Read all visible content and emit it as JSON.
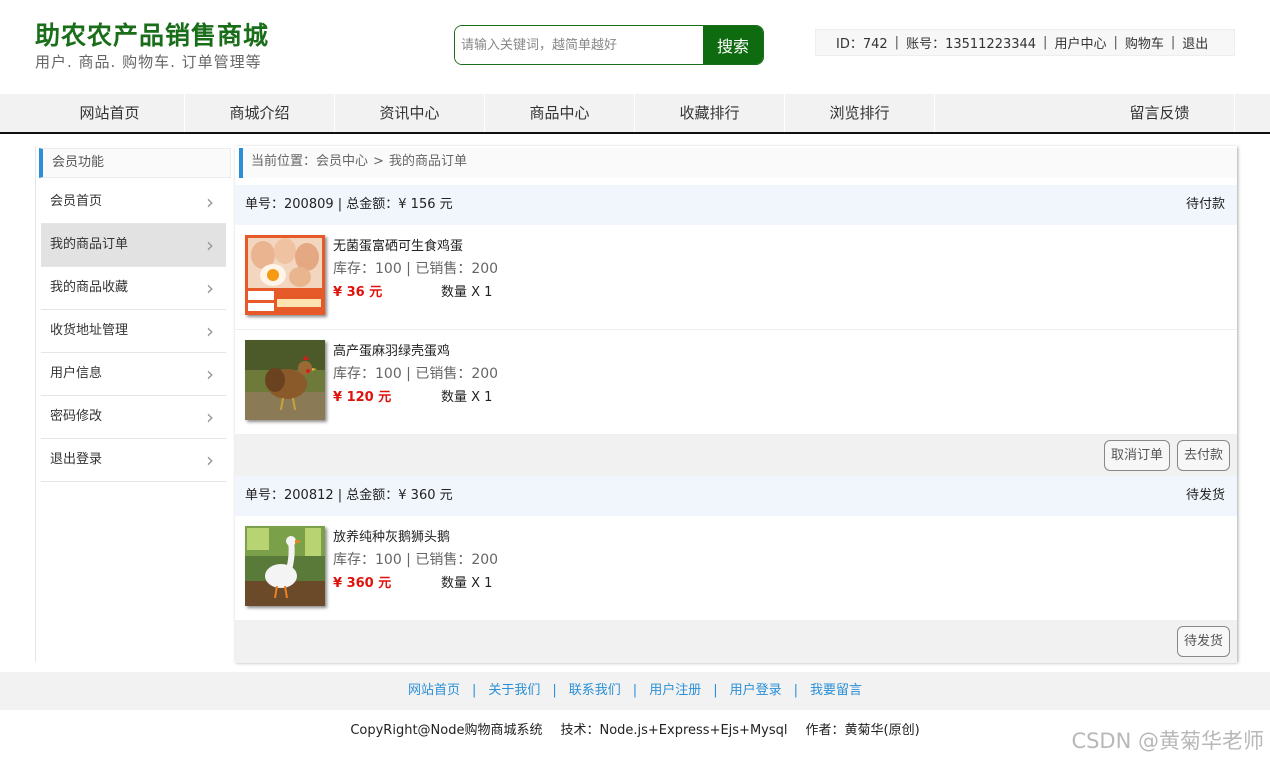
{
  "header": {
    "title": "助农农产品销售商城",
    "subtitle": "用户. 商品. 购物车. 订单管理等",
    "search_placeholder": "请输入关键词，越简单越好",
    "search_button": "搜索",
    "user_id": "ID：742",
    "account": "账号：13511223344",
    "links": [
      "用户中心",
      "购物车",
      "退出"
    ]
  },
  "nav": [
    "网站首页",
    "商城介绍",
    "资讯中心",
    "商品中心",
    "收藏排行",
    "浏览排行",
    "留言反馈"
  ],
  "sidebar": {
    "title": "会员功能",
    "items": [
      "会员首页",
      "我的商品订单",
      "我的商品收藏",
      "收货地址管理",
      "用户信息",
      "密码修改",
      "退出登录"
    ],
    "active_index": 1
  },
  "breadcrumb": {
    "label": "当前位置：",
    "path": [
      "会员中心",
      "我的商品订单"
    ],
    "separator": ">"
  },
  "orders": [
    {
      "info": "单号：200809 | 总金额：¥ 156 元",
      "status": "待付款",
      "items": [
        {
          "name": "无菌蛋富硒可生食鸡蛋",
          "stock": "库存：100 | 已销售：200",
          "price": "¥ 36 元",
          "qty": "数量 X 1",
          "image": "eggs-image"
        },
        {
          "name": "高产蛋麻羽绿壳蛋鸡",
          "stock": "库存：100 | 已销售：200",
          "price": "¥ 120 元",
          "qty": "数量 X 1",
          "image": "chicken-image"
        }
      ],
      "buttons": [
        "取消订单",
        "去付款"
      ]
    },
    {
      "info": "单号：200812 | 总金额：¥ 360 元",
      "status": "待发货",
      "items": [
        {
          "name": "放养纯种灰鹅狮头鹅",
          "stock": "库存：100 | 已销售：200",
          "price": "¥ 360 元",
          "qty": "数量 X 1",
          "image": "goose-image"
        }
      ],
      "buttons": [
        "待发货"
      ]
    }
  ],
  "footer": {
    "links": [
      "网站首页",
      "关于我们",
      "联系我们",
      "用户注册",
      "用户登录",
      "我要留言"
    ],
    "copyright": "CopyRight@Node购物商城系统",
    "tech": "技术：Node.js+Express+Ejs+Mysql",
    "author": "作者：黄菊华(原创)"
  },
  "watermark": "CSDN @黄菊华老师",
  "colors": {
    "brand_green": "#0f6b0f",
    "accent_blue": "#2a8fd6",
    "price_red": "#e0120c"
  }
}
